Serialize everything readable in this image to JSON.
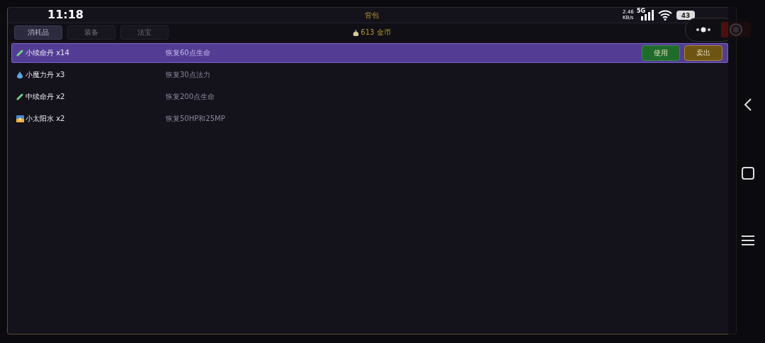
{
  "status_bar": {
    "time": "11:18",
    "speed": "2.46",
    "speed_unit": "KB/s",
    "network": "5G",
    "battery": "43"
  },
  "window": {
    "title": "背包"
  },
  "gold": "613 金币",
  "tabs": [
    {
      "label": "消耗品",
      "selected": true
    },
    {
      "label": "装备",
      "selected": false
    },
    {
      "label": "法宝",
      "selected": false
    }
  ],
  "items": [
    {
      "kind": "pill",
      "name": "小续命丹 x14",
      "description": "恢复60点生命",
      "selected": true,
      "actions": [
        "使用",
        "卖出"
      ]
    },
    {
      "kind": "drop",
      "name": "小魔力丹 x3",
      "description": "恢复30点法力",
      "selected": false
    },
    {
      "kind": "pill",
      "name": "中续命丹 x2",
      "description": "恢复200点生命",
      "selected": false
    },
    {
      "kind": "sunrise",
      "name": "小太阳水 x2",
      "description": "恢复50HP和25MP",
      "selected": false
    }
  ]
}
